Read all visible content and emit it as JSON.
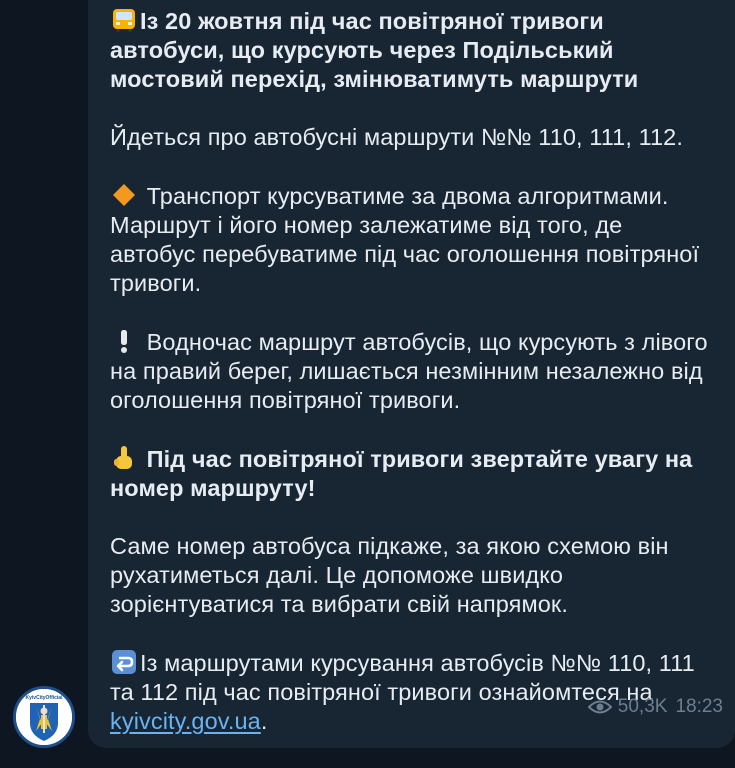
{
  "message": {
    "paragraphs": [
      {
        "id": "p1",
        "emoji": "bus-icon",
        "text": "Із 20 жовтня під час повітряної тривоги автобуси, що курсують через Подільський мостовий перехід, змінюватимуть маршрути",
        "bold": true
      },
      {
        "id": "p2",
        "emoji": null,
        "text": "Йдеться про автобусні маршрути №№ 110, 111, 112.",
        "bold": false
      },
      {
        "id": "p3",
        "emoji": "orange-diamond-icon",
        "text": "Транспорт курсуватиме за двома алгоритмами. Маршрут і його номер залежатиме від того, де автобус перебуватиме під час оголошення повітряної тривоги.",
        "bold": false
      },
      {
        "id": "p4",
        "emoji": "exclamation-icon",
        "text": "Водночас маршрут автобусів, що курсують з лівого на правий берег, лишається незмінним незалежно від оголошення повітряної тривоги.",
        "bold": false
      },
      {
        "id": "p5",
        "emoji": "pointing-up-icon",
        "text": "Під час повітряної тривоги звертайте увагу на номер маршруту!",
        "bold": true
      },
      {
        "id": "p6",
        "emoji": null,
        "text": "Саме номер автобуса підкаже, за якою схемою він рухатиметься далі. Це допоможе швидко зорієнтуватися та вибрати свій напрямок.",
        "bold": false
      }
    ],
    "last_paragraph": {
      "emoji": "return-arrow-icon",
      "text_before": "Із маршрутами курсування автобусів №№ 110, 111 та 112 під час повітряної тривоги ознайомтеся на ",
      "link_text": "kyivcity.gov.ua",
      "text_after": "."
    },
    "views": "50,3K",
    "time": "18:23"
  },
  "channel": {
    "avatar_label": "KyivCityOfficial"
  },
  "colors": {
    "bubble": "#182533",
    "text": "#e6ecf2",
    "link": "#6ab3f3",
    "meta": "#6d7f8f"
  }
}
